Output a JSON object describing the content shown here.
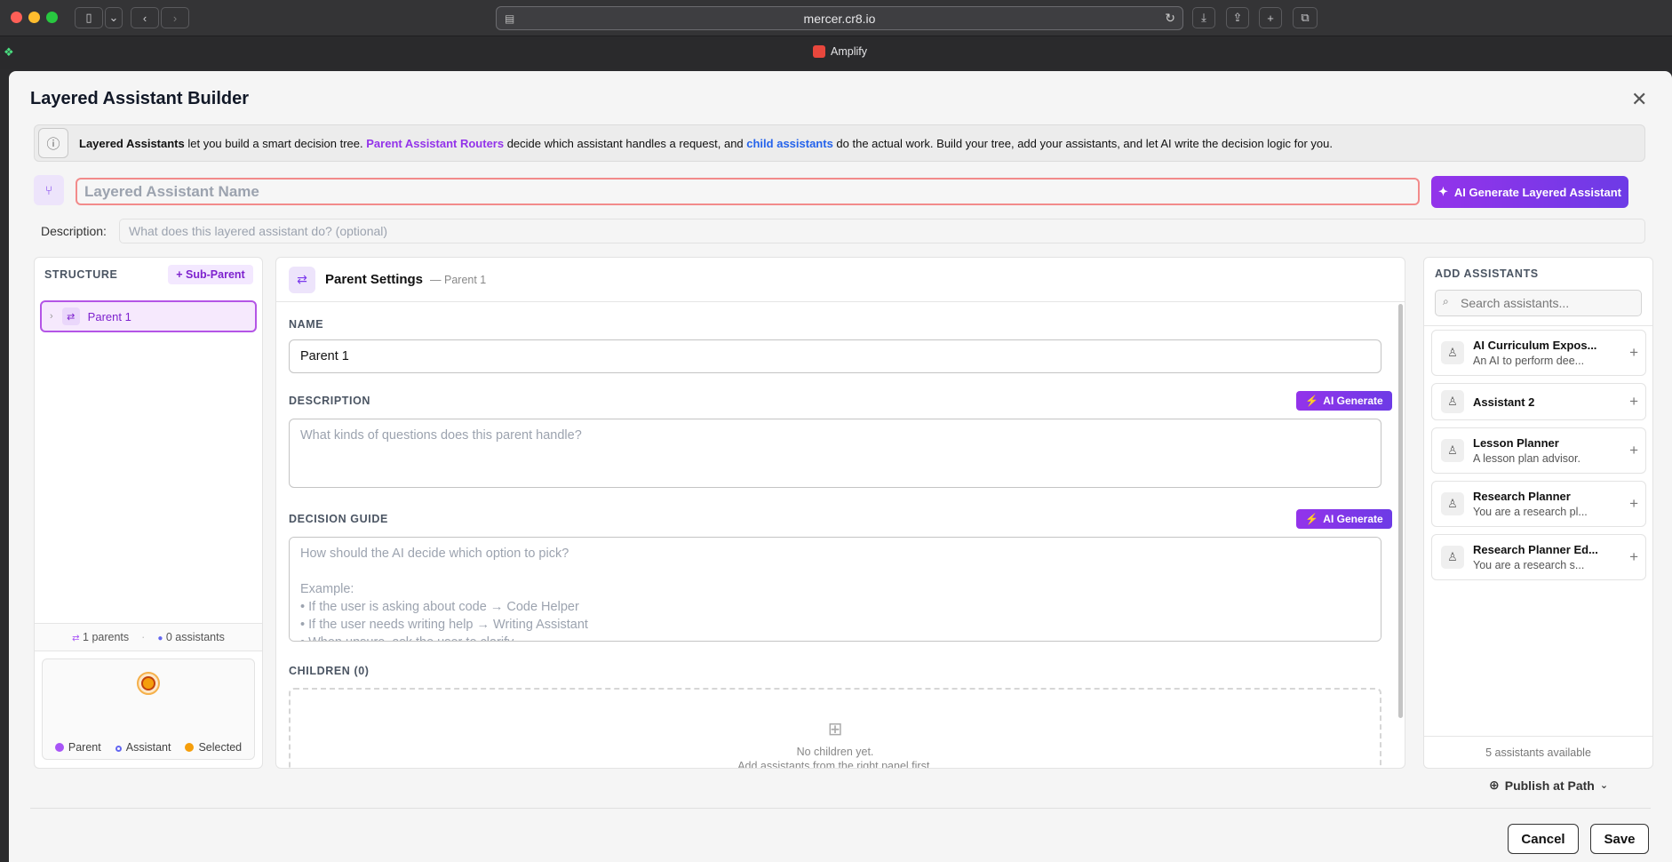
{
  "browser": {
    "url": "mercer.cr8.io",
    "tab_title": "Amplify",
    "colors": {
      "close": "#ff5f57",
      "minimize": "#febc2e",
      "zoom": "#28c840"
    }
  },
  "modal": {
    "title": "Layered Assistant Builder",
    "info": {
      "t1": "Layered Assistants",
      "t2": " let you build a smart decision tree. ",
      "t3": "Parent Assistant Routers",
      "t4": " decide which assistant handles a request, and ",
      "t5": "child assistants",
      "t6": " do the actual work. Build your tree, add your assistants, and let AI write the decision logic for you."
    },
    "name_placeholder": "Layered Assistant Name",
    "ai_generate_layered_label": "AI Generate Layered Assistant",
    "description_label": "Description:",
    "description_placeholder": "What does this layered assistant do? (optional)"
  },
  "structure": {
    "heading": "STRUCTURE",
    "sub_parent_label": "+ Sub-Parent",
    "tree": [
      {
        "label": "Parent 1",
        "selected": true
      }
    ],
    "stats": {
      "parents": "1 parents",
      "assistants": "0 assistants"
    },
    "legend": [
      {
        "label": "Parent",
        "color": "#a855f7"
      },
      {
        "label": "Assistant",
        "color": "#6366f1"
      },
      {
        "label": "Selected",
        "color": "#f59e0b"
      }
    ]
  },
  "settings": {
    "title": "Parent Settings",
    "subtitle": "— Parent 1",
    "name_label": "NAME",
    "name_value": "Parent 1",
    "description_label": "DESCRIPTION",
    "description_placeholder": "What kinds of questions does this parent handle?",
    "ai_generate_label": "AI Generate",
    "decision_label": "DECISION GUIDE",
    "decision_placeholder": "How should the AI decide which option to pick?\n\nExample:\n• If the user is asking about code → Code Helper\n• If the user needs writing help → Writing Assistant\n• When unsure, ask the user to clarify",
    "children_label": "CHILDREN (0)",
    "children_empty_1": "No children yet.",
    "children_empty_2": "Add assistants from the right panel first."
  },
  "assistants": {
    "heading": "ADD ASSISTANTS",
    "search_placeholder": "Search assistants...",
    "items": [
      {
        "name": "AI Curriculum Expos...",
        "desc": "An AI to perform dee..."
      },
      {
        "name": "Assistant 2",
        "desc": ""
      },
      {
        "name": "Lesson Planner",
        "desc": "A lesson plan advisor."
      },
      {
        "name": "Research Planner",
        "desc": "You are a research pl..."
      },
      {
        "name": "Research Planner Ed...",
        "desc": "You are a research s..."
      }
    ],
    "footer": "5 assistants available"
  },
  "footer": {
    "publish_label": "Publish at Path",
    "cancel_label": "Cancel",
    "save_label": "Save"
  }
}
